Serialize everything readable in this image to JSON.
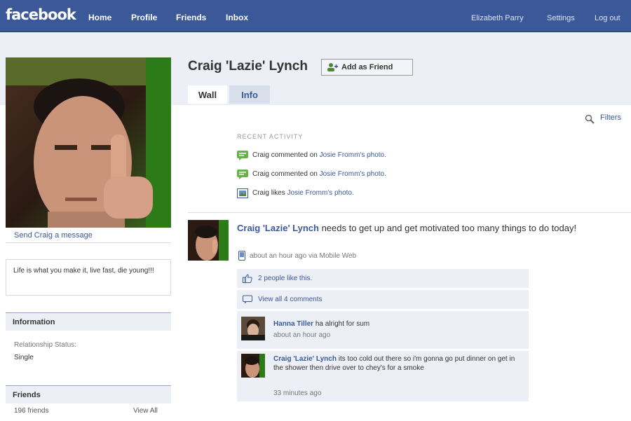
{
  "topbar": {
    "logo": "facebook",
    "nav": [
      "Home",
      "Profile",
      "Friends",
      "Inbox"
    ],
    "user": "Elizabeth Parry",
    "settings": "Settings",
    "logout": "Log out"
  },
  "sidebar": {
    "send_message": "Send Craig a message",
    "bio": "Life is what you make it, live fast, die young!!!",
    "information_title": "Information",
    "relationship_label": "Relationship Status:",
    "relationship_value": "Single",
    "friends_title": "Friends",
    "friends_count": "196 friends",
    "friends_view_all": "View All"
  },
  "profile": {
    "name": "Craig 'Lazie' Lynch",
    "add_friend": "Add as Friend",
    "tabs": [
      "Wall",
      "Info"
    ],
    "filters": "Filters"
  },
  "recent_activity": {
    "heading": "RECENT ACTIVITY",
    "items": [
      {
        "actor": "Craig",
        "verb": "commented on",
        "target": "Josie Fromm's photo."
      },
      {
        "actor": "Craig",
        "verb": "commented on",
        "target": "Josie Fromm's photo."
      },
      {
        "actor": "Craig",
        "verb": "likes",
        "target": "Josie Fromm's photo."
      }
    ]
  },
  "post": {
    "author": "Craig 'Lazie' Lynch",
    "text": " needs to get up and get motivated too many things to do today!",
    "meta": "about an hour ago via Mobile Web",
    "likes": "2 people like this.",
    "view_comments": "View all 4 comments",
    "comments": [
      {
        "author": "Hanna Tiller",
        "text": " ha alright for sum",
        "time": "about an hour ago"
      },
      {
        "author": "Craig 'Lazie' Lynch",
        "text": " its too cold out there so i'm gonna go put dinner on get in the shower then drive over to chey's for a smoke",
        "time": "33 minutes ago"
      }
    ]
  },
  "colors": {
    "brand": "#3b5998",
    "light_blue_bg": "#eceff5",
    "tab_info_bg": "#d8dfea"
  }
}
